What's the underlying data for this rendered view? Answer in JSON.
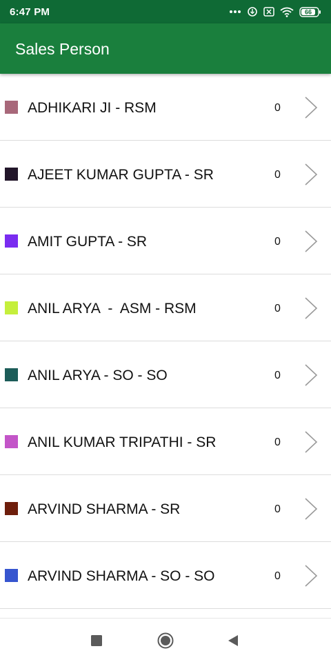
{
  "status_bar": {
    "time": "6:47 PM",
    "battery": "66",
    "icons": [
      "more-dots-icon",
      "sync-icon",
      "close-box-icon",
      "wifi-icon",
      "battery-icon"
    ]
  },
  "app_bar": {
    "title": "Sales Person"
  },
  "list": {
    "items": [
      {
        "name": "ADHIKARI JI - RSM",
        "count": "0",
        "color": "#a8687a"
      },
      {
        "name": "AJEET KUMAR GUPTA - SR",
        "count": "0",
        "color": "#22162a"
      },
      {
        "name": "AMIT GUPTA - SR",
        "count": "0",
        "color": "#7a2cf0"
      },
      {
        "name": "ANIL ARYA  -  ASM - RSM",
        "count": "0",
        "color": "#c5ef3c"
      },
      {
        "name": "ANIL ARYA - SO - SO",
        "count": "0",
        "color": "#1c5c58"
      },
      {
        "name": "ANIL KUMAR TRIPATHI - SR",
        "count": "0",
        "color": "#c355c8"
      },
      {
        "name": "ARVIND SHARMA - SR",
        "count": "0",
        "color": "#6e1e0c"
      },
      {
        "name": "ARVIND SHARMA - SO - SO",
        "count": "0",
        "color": "#3655cf"
      }
    ]
  },
  "nav_bar": {
    "icons": [
      "recents-square-icon",
      "home-circle-icon",
      "back-triangle-icon"
    ]
  },
  "colors": {
    "status_bar": "#0f6a35",
    "app_bar": "#1a7f3d",
    "divider": "#dcdcdc",
    "chevron": "#9a9a9a"
  }
}
